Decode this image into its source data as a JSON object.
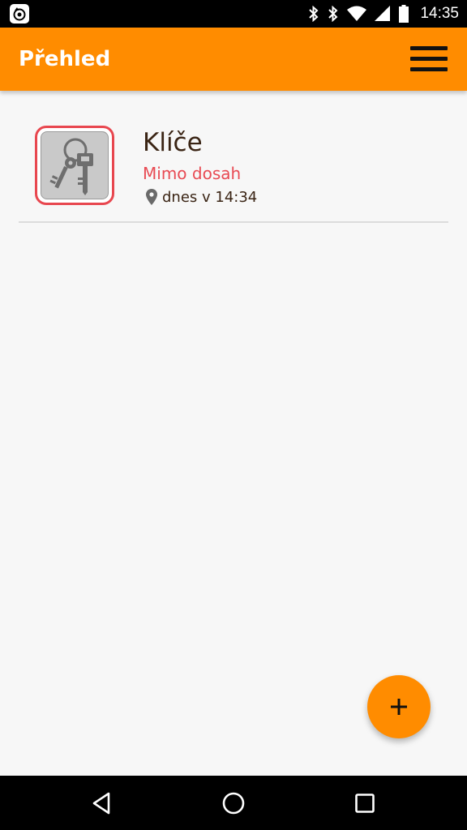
{
  "status_bar": {
    "time": "14:35",
    "icons": [
      "app-notification-icon",
      "bluetooth-icon",
      "bluetooth-icon",
      "wifi-icon",
      "signal-icon",
      "battery-icon"
    ]
  },
  "app_bar": {
    "title": "Přehled",
    "menu_icon": "hamburger-menu-icon",
    "background_color": "#ff8c00"
  },
  "devices": [
    {
      "name": "Klíče",
      "status": "Mimo dosah",
      "status_color": "#e84a53",
      "location_icon": "location-pin-icon",
      "last_seen": "dnes v 14:34",
      "thumbnail_icon": "keys-icon"
    }
  ],
  "fab": {
    "icon": "plus-icon",
    "color": "#ff8c00"
  },
  "nav_bar": {
    "icons": [
      "back-icon",
      "home-icon",
      "recents-icon"
    ]
  }
}
